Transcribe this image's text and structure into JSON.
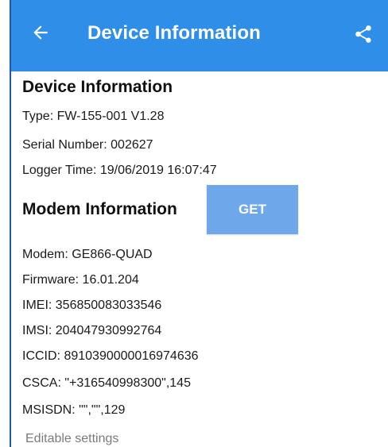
{
  "app_bar": {
    "title": "Device Information",
    "back_icon": "arrow-left-icon",
    "share_icon": "share-icon",
    "color": "#2f8fe8"
  },
  "device_info": {
    "heading": "Device Information",
    "type": "Type: FW-155-001 V1.28",
    "serial": "Serial Number:  002627",
    "logger_time": "Logger Time: 19/06/2019 16:07:47"
  },
  "modem_info": {
    "heading": "Modem Information",
    "get_button": "GET",
    "modem": "Modem:  GE866-QUAD",
    "firmware": "Firmware:  16.01.204",
    "imei": "IMEI: 356850083033546",
    "imsi": "IMSI: 204047930992764",
    "iccid": "ICCID: 8910390000016974636",
    "csca": "CSCA: \"+316540998300\",145",
    "msisdn": "MSISDN: \"\",\"\",129"
  },
  "editable_settings": "Editable settings",
  "colors": {
    "button": "#6ea8ea",
    "muted_text": "#7a7a7a"
  }
}
